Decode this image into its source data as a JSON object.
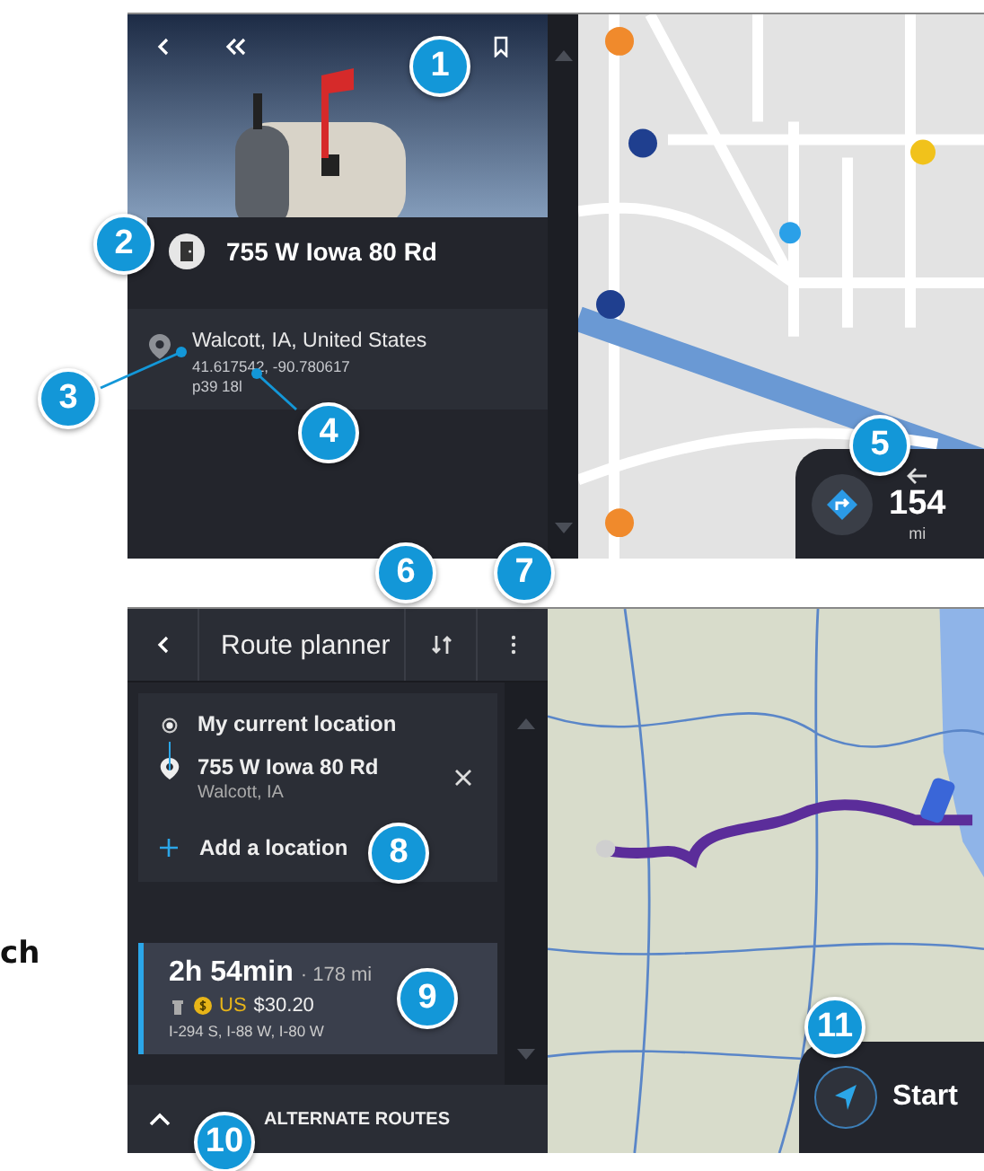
{
  "page_fragments": [
    "ch"
  ],
  "place_screen": {
    "title": "755 W Iowa 80 Rd",
    "location": "Walcott, IA, United States",
    "coordinates": "41.617542, -90.780617",
    "code": "p39 18l",
    "next_turn": {
      "distance": "154",
      "unit": "mi"
    }
  },
  "route_planner": {
    "title": "Route planner",
    "stops": [
      {
        "kind": "origin",
        "name": "My current location"
      },
      {
        "kind": "destination",
        "name": "755 W Iowa 80 Rd",
        "detail": "Walcott, IA"
      }
    ],
    "add_label": "Add a location",
    "route": {
      "duration": "2h 54min",
      "distance": "· 178 mi",
      "toll_prefix": "US",
      "toll": "$30.20",
      "roads": "I-294 S, I-88 W, I-80 W",
      "selected": true
    },
    "alternate_label": "ALTERNATE ROUTES",
    "start_label": "Start"
  },
  "callouts": [
    "1",
    "2",
    "3",
    "4",
    "5",
    "6",
    "7",
    "8",
    "9",
    "10",
    "11"
  ]
}
